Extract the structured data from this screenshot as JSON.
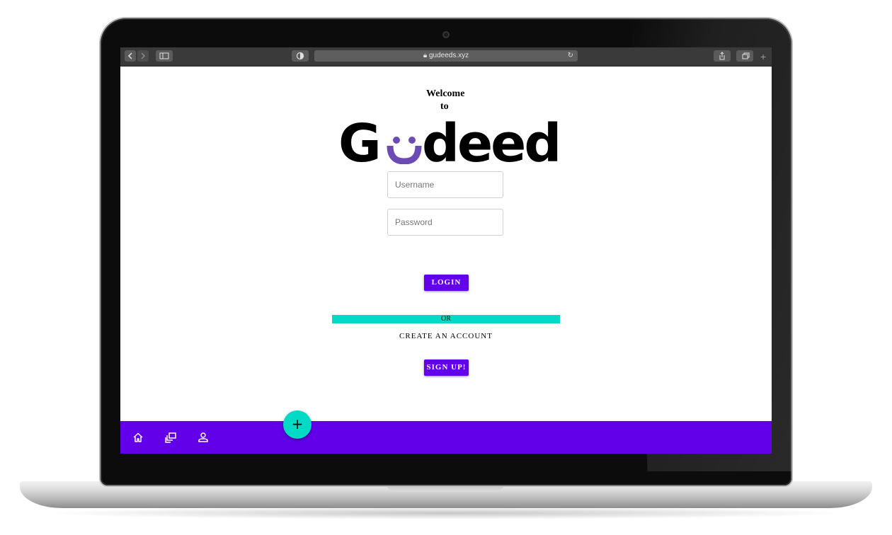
{
  "browser": {
    "url": "gudeeds.xyz",
    "icons": [
      "back-icon",
      "forward-icon",
      "sidebar-icon",
      "shield-icon",
      "lock-icon",
      "reload-icon",
      "share-icon",
      "tabs-icon",
      "new-tab-icon"
    ]
  },
  "page": {
    "welcome_line1": "Welcome",
    "welcome_line2": "to",
    "logo_text": "Gudeeds",
    "username_placeholder": "Username",
    "password_placeholder": "Password",
    "login_label": "LOGIN",
    "or_label": "OR",
    "create_account_label": "CREATE AN ACCOUNT",
    "signup_label": "SIGN UP!"
  },
  "bottom_nav": {
    "items": [
      "home-icon",
      "collections-icon",
      "profile-icon"
    ],
    "fab_label": "+"
  },
  "colors": {
    "primary": "#6200ea",
    "accent": "#03dac5",
    "logo_smile": "#6c4bb4"
  }
}
